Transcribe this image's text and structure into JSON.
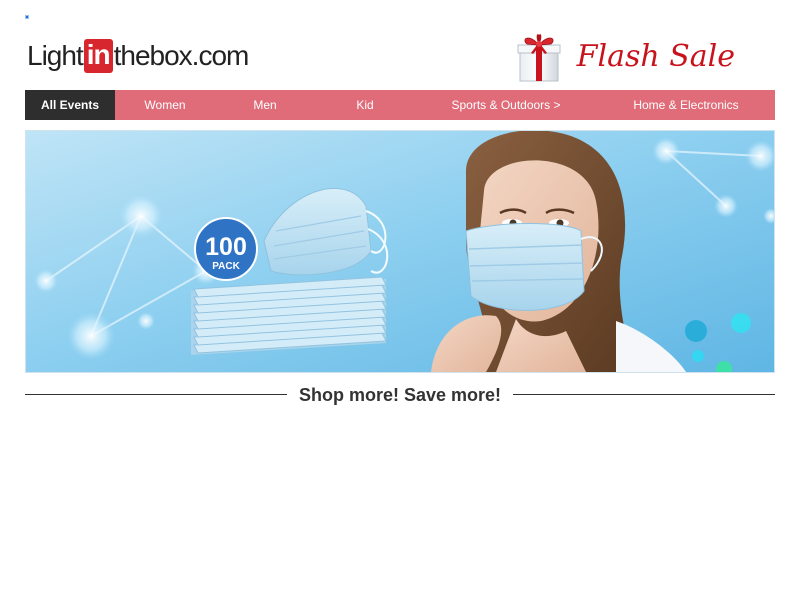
{
  "header": {
    "logo": {
      "part1": "Light",
      "part2": "in",
      "part3": "thebox.com"
    },
    "flash_sale": "Flash Sale",
    "gift_icon": "gift-box-icon"
  },
  "nav": {
    "items": [
      {
        "label": "All Events",
        "active": true
      },
      {
        "label": "Women",
        "active": false
      },
      {
        "label": "Men",
        "active": false
      },
      {
        "label": "Kid",
        "active": false
      },
      {
        "label": "Sports & Outdoors >",
        "active": false
      },
      {
        "label": "Home & Electronics",
        "active": false
      }
    ]
  },
  "banner": {
    "badge_number": "100",
    "badge_text": "PACK"
  },
  "slogan": "Shop more! Save more!",
  "colors": {
    "nav_bg": "#e06c79",
    "nav_active_bg": "#2e2e2e",
    "flash_red": "#c8121c",
    "logo_red": "#d8262e",
    "banner_blue": "#7cc4ea",
    "badge_blue": "#2f73c4"
  }
}
